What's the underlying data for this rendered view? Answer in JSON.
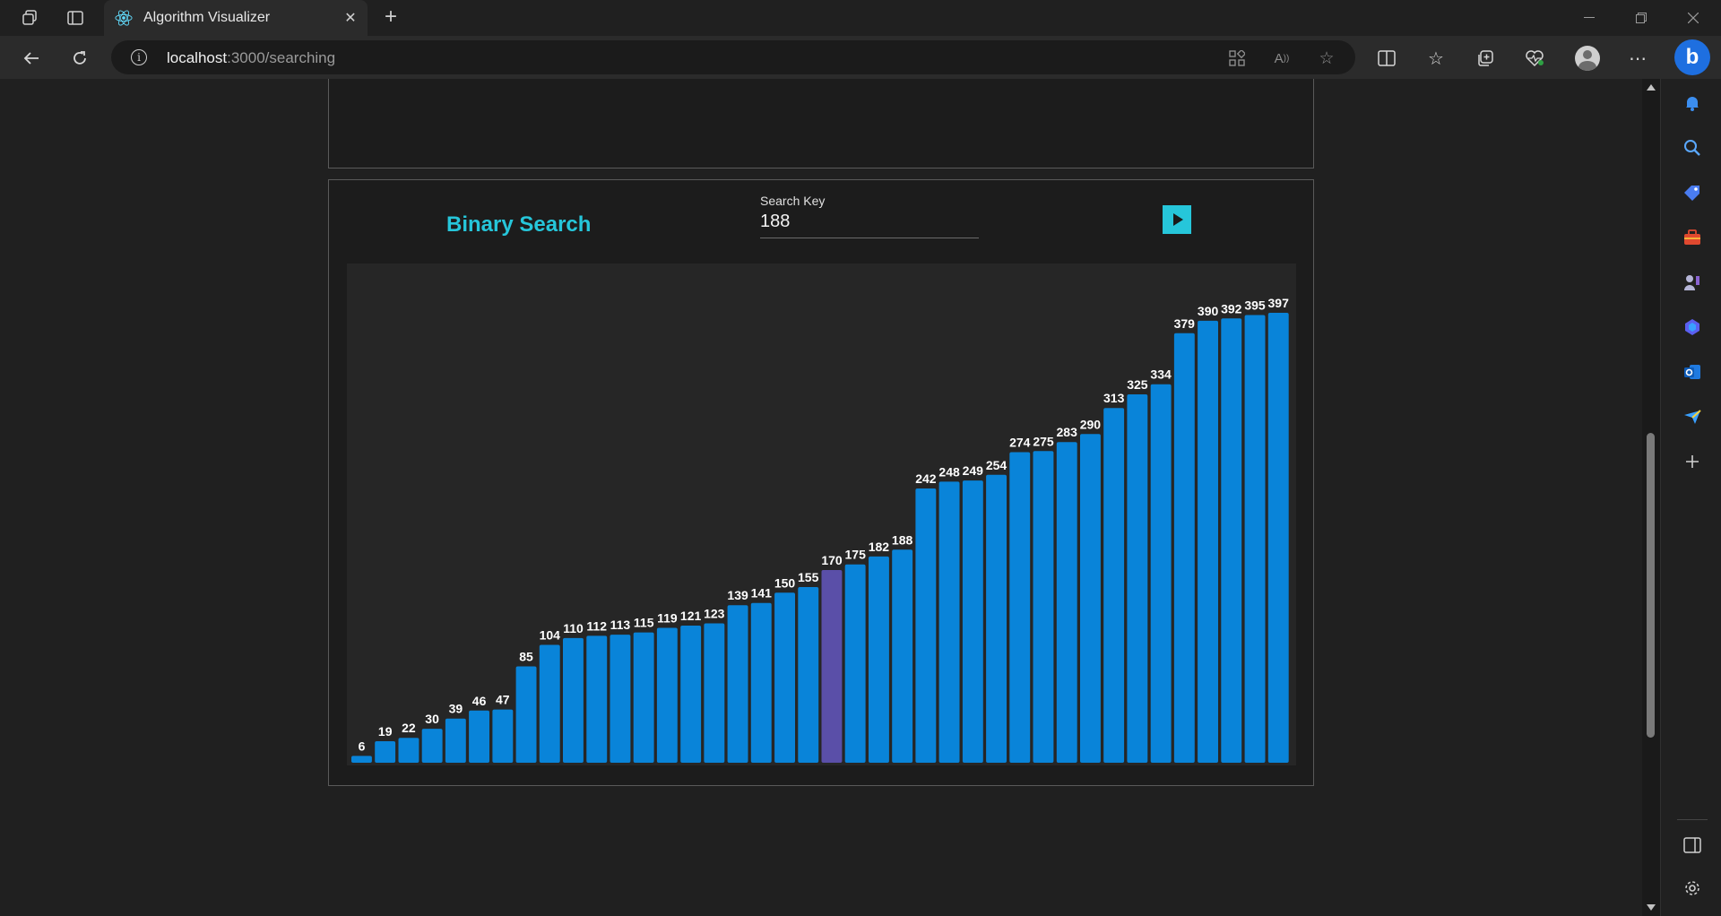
{
  "browser": {
    "tab_title": "Algorithm Visualizer",
    "url_host": "localhost",
    "url_path": ":3000/searching"
  },
  "toolbar_icons": [
    "apps-icon",
    "read-aloud-icon",
    "favorite-star-icon",
    "split-screen-icon",
    "favorites-icon",
    "collections-icon",
    "browser-essentials-icon",
    "profile-icon",
    "more-icon",
    "bing-icon"
  ],
  "sidebar_icons": [
    "bell-icon",
    "search-icon",
    "shopping-tag-icon",
    "tools-icon",
    "games-icon",
    "copilot-icon",
    "outlook-icon",
    "send-icon",
    "add-icon",
    "hide-sidebar-icon",
    "settings-icon"
  ],
  "panel": {
    "title": "Binary Search",
    "search_key_label": "Search Key",
    "search_key_value": "188",
    "accent_color": "#26c6da"
  },
  "chart_data": {
    "type": "bar",
    "values": [
      6,
      19,
      22,
      30,
      39,
      46,
      47,
      85,
      104,
      110,
      112,
      113,
      115,
      119,
      121,
      123,
      139,
      141,
      150,
      155,
      170,
      175,
      182,
      188,
      242,
      248,
      249,
      254,
      274,
      275,
      283,
      290,
      313,
      325,
      334,
      379,
      390,
      392,
      395,
      397
    ],
    "highlight_index": 20,
    "bar_color": "#0984d9",
    "highlight_color": "#5a4fa8",
    "label_color": "#ffffff"
  }
}
